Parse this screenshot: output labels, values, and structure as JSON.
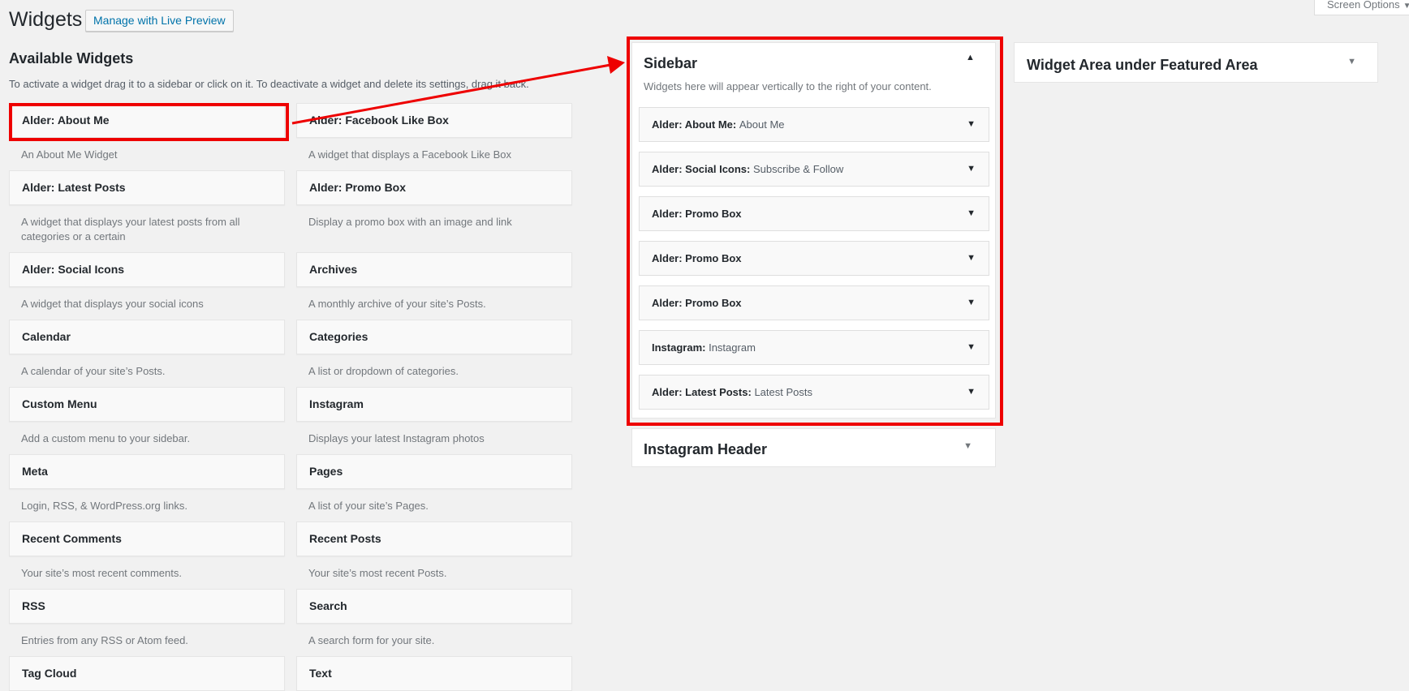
{
  "header": {
    "title": "Widgets",
    "live_preview_label": "Manage with Live Preview",
    "screen_options_label": "Screen Options"
  },
  "available": {
    "title": "Available Widgets",
    "description": "To activate a widget drag it to a sidebar or click on it. To deactivate a widget and delete its settings, drag it back."
  },
  "widgets": [
    {
      "title": "Alder: About Me",
      "desc": "An About Me Widget"
    },
    {
      "title": "Alder: Facebook Like Box",
      "desc": "A widget that displays a Facebook Like Box"
    },
    {
      "title": "Alder: Latest Posts",
      "desc": "A widget that displays your latest posts from all categories or a certain"
    },
    {
      "title": "Alder: Promo Box",
      "desc": "Display a promo box with an image and link"
    },
    {
      "title": "Alder: Social Icons",
      "desc": "A widget that displays your social icons"
    },
    {
      "title": "Archives",
      "desc": "A monthly archive of your site’s Posts."
    },
    {
      "title": "Calendar",
      "desc": "A calendar of your site’s Posts."
    },
    {
      "title": "Categories",
      "desc": "A list or dropdown of categories."
    },
    {
      "title": "Custom Menu",
      "desc": "Add a custom menu to your sidebar."
    },
    {
      "title": "Instagram",
      "desc": "Displays your latest Instagram photos"
    },
    {
      "title": "Meta",
      "desc": "Login, RSS, & WordPress.org links."
    },
    {
      "title": "Pages",
      "desc": "A list of your site’s Pages."
    },
    {
      "title": "Recent Comments",
      "desc": "Your site’s most recent comments."
    },
    {
      "title": "Recent Posts",
      "desc": "Your site’s most recent Posts."
    },
    {
      "title": "RSS",
      "desc": "Entries from any RSS or Atom feed."
    },
    {
      "title": "Search",
      "desc": "A search form for your site."
    },
    {
      "title": "Tag Cloud",
      "desc": ""
    },
    {
      "title": "Text",
      "desc": ""
    }
  ],
  "sidebar": {
    "title": "Sidebar",
    "description": "Widgets here will appear vertically to the right of your content.",
    "items": [
      {
        "name": "Alder: About Me:",
        "sub": "About Me"
      },
      {
        "name": "Alder: Social Icons:",
        "sub": "Subscribe & Follow"
      },
      {
        "name": "Alder: Promo Box",
        "sub": ""
      },
      {
        "name": "Alder: Promo Box",
        "sub": ""
      },
      {
        "name": "Alder: Promo Box",
        "sub": ""
      },
      {
        "name": "Instagram:",
        "sub": "Instagram"
      },
      {
        "name": "Alder: Latest Posts:",
        "sub": "Latest Posts"
      }
    ]
  },
  "instagram_header": {
    "title": "Instagram Header"
  },
  "featured_area": {
    "title": "Widget Area under Featured Area"
  },
  "colors": {
    "highlight": "#e00000",
    "link": "#0073aa"
  },
  "icons": {
    "expand": "arrow-down-icon",
    "collapse": "arrow-up-icon"
  }
}
